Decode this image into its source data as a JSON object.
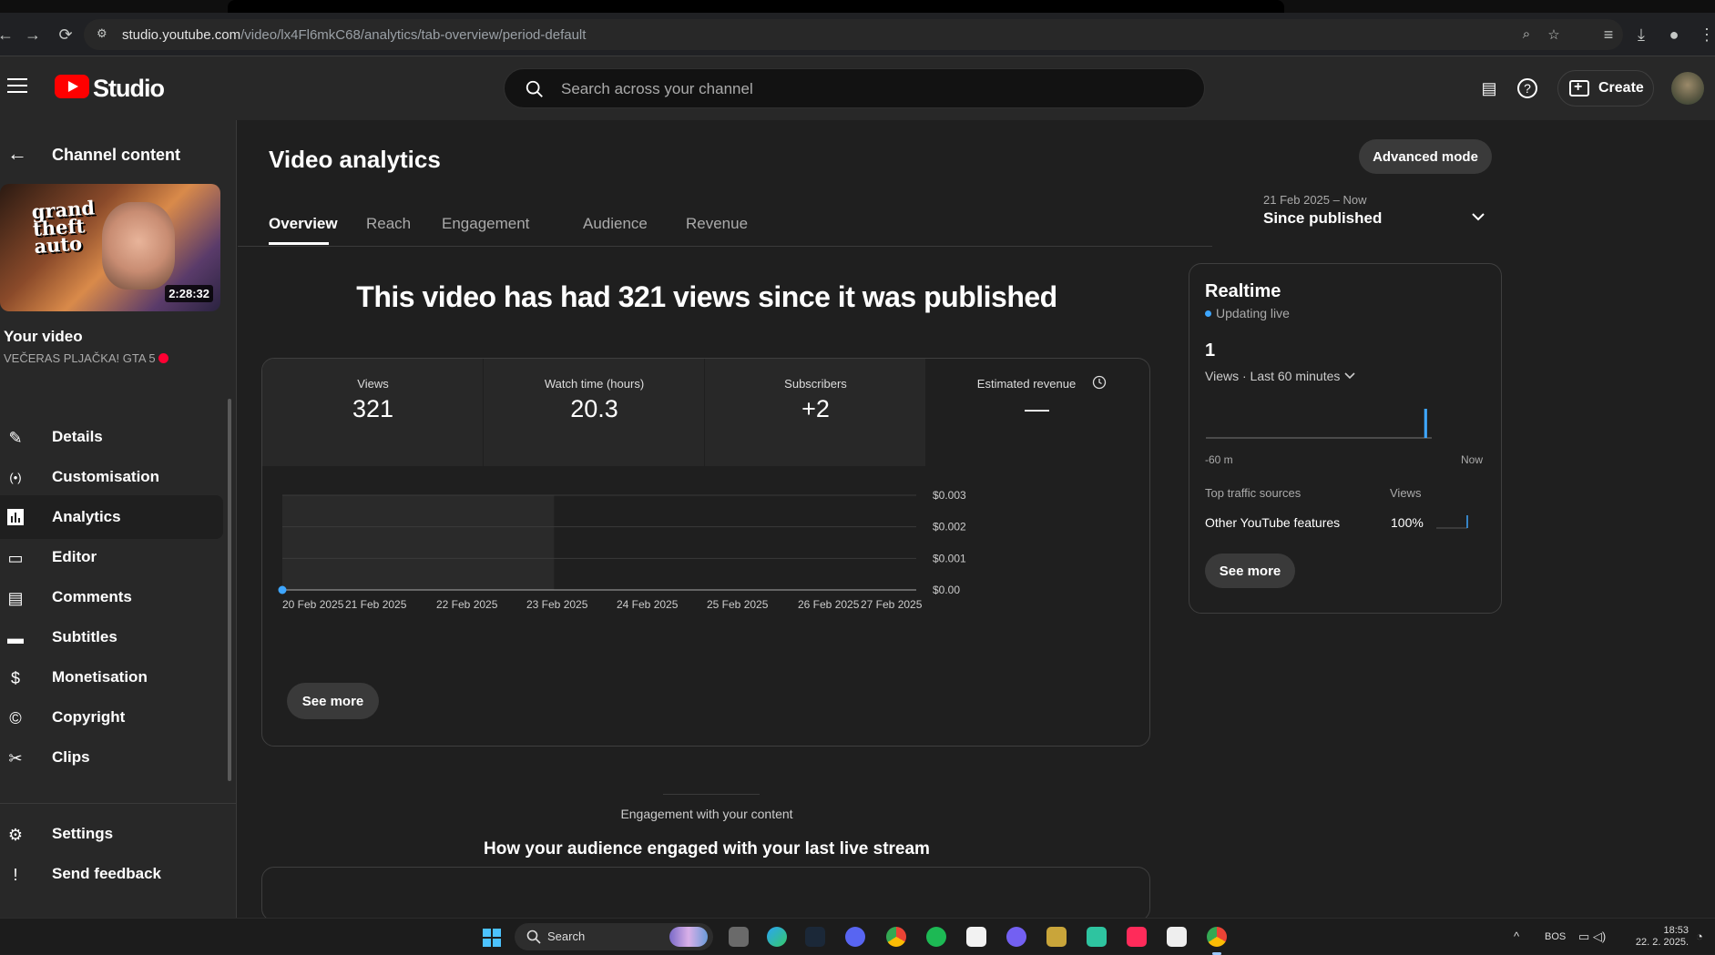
{
  "browser": {
    "url_host": "studio.youtube.com",
    "url_path": "/video/lx4Fl6mkC68/analytics/tab-overview/period-default"
  },
  "header": {
    "logo_text": "Studio",
    "search_placeholder": "Search across your channel",
    "create_label": "Create"
  },
  "sidebar": {
    "back_label": "Channel content",
    "thumbnail_duration": "2:28:32",
    "thumbnail_text": "grand theft auto",
    "your_video_label": "Your video",
    "video_title": "VEČERAS PLJAČKA! GTA 5",
    "items": [
      {
        "label": "Details",
        "icon": "pencil-icon"
      },
      {
        "label": "Customisation",
        "icon": "broadcast-icon"
      },
      {
        "label": "Analytics",
        "icon": "analytics-icon",
        "active": true
      },
      {
        "label": "Editor",
        "icon": "film-icon"
      },
      {
        "label": "Comments",
        "icon": "comment-icon"
      },
      {
        "label": "Subtitles",
        "icon": "subtitles-icon"
      },
      {
        "label": "Monetisation",
        "icon": "dollar-icon"
      },
      {
        "label": "Copyright",
        "icon": "copyright-icon"
      },
      {
        "label": "Clips",
        "icon": "scissors-icon"
      }
    ],
    "settings_label": "Settings",
    "feedback_label": "Send feedback"
  },
  "main": {
    "title": "Video analytics",
    "advanced_mode_label": "Advanced mode",
    "tabs": [
      {
        "label": "Overview",
        "active": true
      },
      {
        "label": "Reach"
      },
      {
        "label": "Engagement"
      },
      {
        "label": "Audience"
      },
      {
        "label": "Revenue"
      }
    ],
    "date_range": "21 Feb 2025 – Now",
    "period_label": "Since published",
    "headline": "This video has had 321 views since it was published",
    "metrics": [
      {
        "label": "Views",
        "value": "321"
      },
      {
        "label": "Watch time (hours)",
        "value": "20.3"
      },
      {
        "label": "Subscribers",
        "value": "+2"
      },
      {
        "label": "Estimated revenue",
        "value": "—"
      }
    ],
    "see_more_label": "See more",
    "engagement_kicker": "Engagement with your content",
    "engagement_title": "How your audience engaged with your last live stream"
  },
  "chart_data": {
    "type": "line",
    "x": [
      "20 Feb 2025",
      "21 Feb 2025",
      "22 Feb 2025",
      "23 Feb 2025",
      "24 Feb 2025",
      "25 Feb 2025",
      "26 Feb 2025",
      "27 Feb 2025"
    ],
    "series": [
      {
        "values": [
          0,
          null,
          null,
          null,
          null,
          null,
          null,
          null
        ]
      }
    ],
    "yticks": [
      "$0.003",
      "$0.002",
      "$0.001",
      "$0.00"
    ],
    "ylim": [
      0,
      0.003
    ],
    "shaded_range": [
      "20 Feb 2025",
      "23 Feb 2025"
    ],
    "accent": "#3ea6ff",
    "grid": true
  },
  "realtime": {
    "title": "Realtime",
    "status": "Updating live",
    "count": "1",
    "subtitle": "Views · Last 60 minutes",
    "axis_left": "-60 m",
    "axis_right": "Now",
    "sources_header": "Top traffic sources",
    "views_header": "Views",
    "source_name": "Other YouTube features",
    "source_pct": "100%",
    "see_more_label": "See more",
    "minute_views": [
      0,
      0,
      0,
      0,
      0,
      0,
      0,
      0,
      0,
      0,
      0,
      0,
      0,
      0,
      0,
      0,
      0,
      0,
      0,
      0,
      0,
      0,
      0,
      0,
      0,
      0,
      0,
      0,
      0,
      0,
      0,
      0,
      0,
      0,
      0,
      0,
      0,
      0,
      0,
      0,
      0,
      0,
      0,
      0,
      0,
      0,
      0,
      0,
      0,
      0,
      0,
      0,
      0,
      0,
      0,
      0,
      0,
      0,
      1,
      0
    ]
  },
  "taskbar": {
    "search_label": "Search",
    "lang": "BOS",
    "time": "18:53",
    "date": "22. 2. 2025."
  },
  "colors": {
    "accent_blue": "#3ea6ff",
    "yt_red": "#ff0000",
    "live_red": "#ff0033"
  }
}
